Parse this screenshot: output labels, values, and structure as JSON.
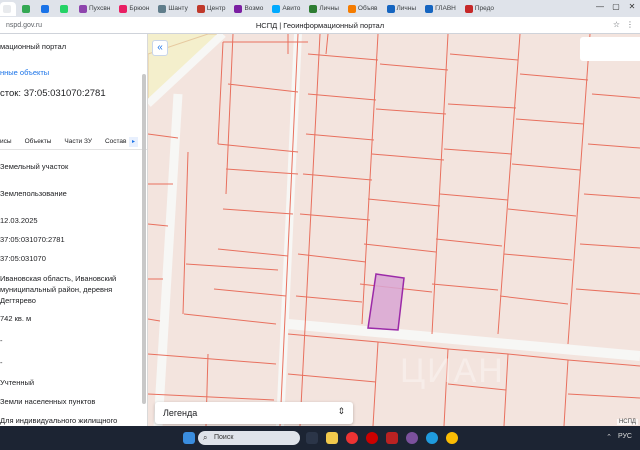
{
  "browser": {
    "tabs": [
      {
        "label": "",
        "color": "#e8eaed"
      },
      {
        "label": "",
        "color": "#34a853"
      },
      {
        "label": "",
        "color": "#1a73e8"
      },
      {
        "label": "",
        "color": "#25d366"
      },
      {
        "label": "Пухсвн",
        "color": "#8e44ad"
      },
      {
        "label": "Брюон",
        "color": "#e91e63"
      },
      {
        "label": "Шанту",
        "color": "#607d8b"
      },
      {
        "label": "Центр",
        "color": "#c0392b"
      },
      {
        "label": "Возмо",
        "color": "#7b1fa2"
      },
      {
        "label": "Авито",
        "color": "#00aaff"
      },
      {
        "label": "Личны",
        "color": "#2e7d32"
      },
      {
        "label": "Объяв",
        "color": "#f57c00"
      },
      {
        "label": "Личны",
        "color": "#1565c0"
      },
      {
        "label": "ГЛАВН",
        "color": "#1565c0"
      },
      {
        "label": "Предо",
        "color": "#c62828"
      }
    ],
    "window_controls": [
      "—",
      "▢",
      "✕"
    ],
    "url": "nspd.gov.ru",
    "page_title": "НСПД | Геоинформационный портал"
  },
  "panel": {
    "header": "мационный портал",
    "breadcrumb": "нные объекты",
    "title": "сток: 37:05:031070:2781",
    "subtabs": [
      "исы",
      "Объекты",
      "Части ЗУ",
      "Состав"
    ],
    "next_label": "▸",
    "fields": [
      {
        "text": "Земельный участок"
      },
      {
        "text": "Землепользование"
      },
      {
        "text": "12.03.2025"
      },
      {
        "text": "37:05:031070:2781"
      },
      {
        "text": "37:05:031070"
      },
      {
        "text": "Ивановская область, Ивановский"
      },
      {
        "text": "муниципальный район, деревня"
      },
      {
        "text": "Дегтярево"
      },
      {
        "text": "742 кв. м"
      },
      {
        "text": "-"
      },
      {
        "text": "-"
      },
      {
        "text": "Учтенный"
      },
      {
        "text": "Земли населенных пунктов"
      },
      {
        "text": "Для индивидуального жилищного"
      }
    ]
  },
  "map": {
    "collapse_label": "«",
    "legend_label": "Легенда",
    "legend_chevron": "⌃⌄",
    "attribution": "НСПД",
    "watermark": "ЦИАН",
    "colors": {
      "background": "#f3e4de",
      "parcel_line": "#e8705e",
      "road": "#f7f7f5",
      "highlight_fill": "#d8a6d4",
      "highlight_stroke": "#9b2aa8",
      "top_strip": "#f4efcc"
    }
  },
  "taskbar": {
    "search_placeholder": "Поиск",
    "lang": "РУС",
    "icons": [
      "windows-icon",
      "file-explorer-icon",
      "yandex-icon",
      "opera-icon",
      "filezilla-icon",
      "viber-icon",
      "edge-icon",
      "chrome-icon"
    ]
  }
}
